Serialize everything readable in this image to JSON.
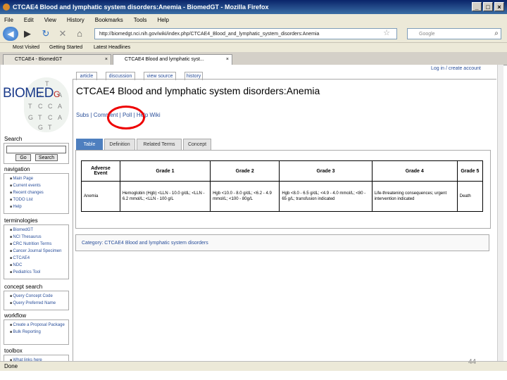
{
  "window": {
    "title": "CTCAE4 Blood and lymphatic system disorders:Anemia - BiomedGT - Mozilla Firefox",
    "controls": [
      "_",
      "□",
      "×"
    ]
  },
  "menu": [
    "File",
    "Edit",
    "View",
    "History",
    "Bookmarks",
    "Tools",
    "Help"
  ],
  "nav": {
    "url": "http://biomedgt.nci.nih.gov/wiki/index.php/CTCAE4_Blood_and_lymphatic_system_disorders:Anemia",
    "search_placeholder": "Google"
  },
  "bookmarks": [
    "Most Visited",
    "Getting Started",
    "Latest Headlines"
  ],
  "tabs": [
    {
      "label": "CTCAE4 - BiomedGT",
      "close": "×"
    },
    {
      "label": "CTCAE4 Blood and lymphatic syst...",
      "close": "×"
    }
  ],
  "top_links": "Log in / create account",
  "page_tabs": [
    "article",
    "discussion",
    "view source",
    "history"
  ],
  "logo": {
    "word": "BIOMED",
    "suffix": "G",
    "grid_letters": [
      "T",
      "G",
      "A",
      "T",
      "C",
      "C",
      "A",
      "G",
      "T",
      "C",
      "A",
      "G",
      "T"
    ]
  },
  "sidebar": {
    "search_heading": "Search",
    "go": "Go",
    "search": "Search",
    "navigation_heading": "navigation",
    "navigation": [
      "Main Page",
      "Current events",
      "Recent changes",
      "TODO List",
      "Help"
    ],
    "terminologies_heading": "terminologies",
    "terminologies": [
      "BiomedGT",
      "NCI Thesaurus",
      "CRC Nutrition Terms",
      "Cancer Journal Specimen",
      "CTCAE4",
      "NDC",
      "Pediatrics Tool"
    ],
    "concept_heading": "concept search",
    "concept": [
      "Query Concept Code",
      "Query Preferred Name"
    ],
    "workflow_heading": "workflow",
    "workflow": [
      "Create a Proposal Package",
      "Bulk Reporting"
    ],
    "toolbox_heading": "toolbox",
    "toolbox": [
      "What links here"
    ]
  },
  "heading": "CTCAE4 Blood and lymphatic system disorders:Anemia",
  "navline": "Subs | Comment | Poll | Help Wiki",
  "inner_tabs": [
    "Table",
    "Definition",
    "Related Terms",
    "Concept"
  ],
  "table": {
    "headers": [
      "Adverse Event",
      "Grade 1",
      "Grade 2",
      "Grade 3",
      "Grade 4",
      "Grade 5"
    ],
    "row": [
      "Anemia",
      "Hemoglobin (Hgb) <LLN - 10.0 g/dL; <LLN - 6.2 mmol/L; <LLN - 100 g/L",
      "Hgb <10.0 - 8.0 g/dL; <6.2 - 4.9 mmol/L; <100 - 80g/L",
      "Hgb <8.0 - 6.5 g/dL; <4.9 - 4.0 mmol/L; <80 - 65 g/L; transfusion indicated",
      "Life-threatening consequences; urgent intervention indicated",
      "Death"
    ]
  },
  "category": "Category: CTCAE4 Blood and lymphatic system disorders",
  "status": "Done",
  "slide_number": "44",
  "colors": {
    "annotation": "#e00000",
    "link": "#2a4f9a",
    "selected_tab": "#4e7fbf"
  }
}
